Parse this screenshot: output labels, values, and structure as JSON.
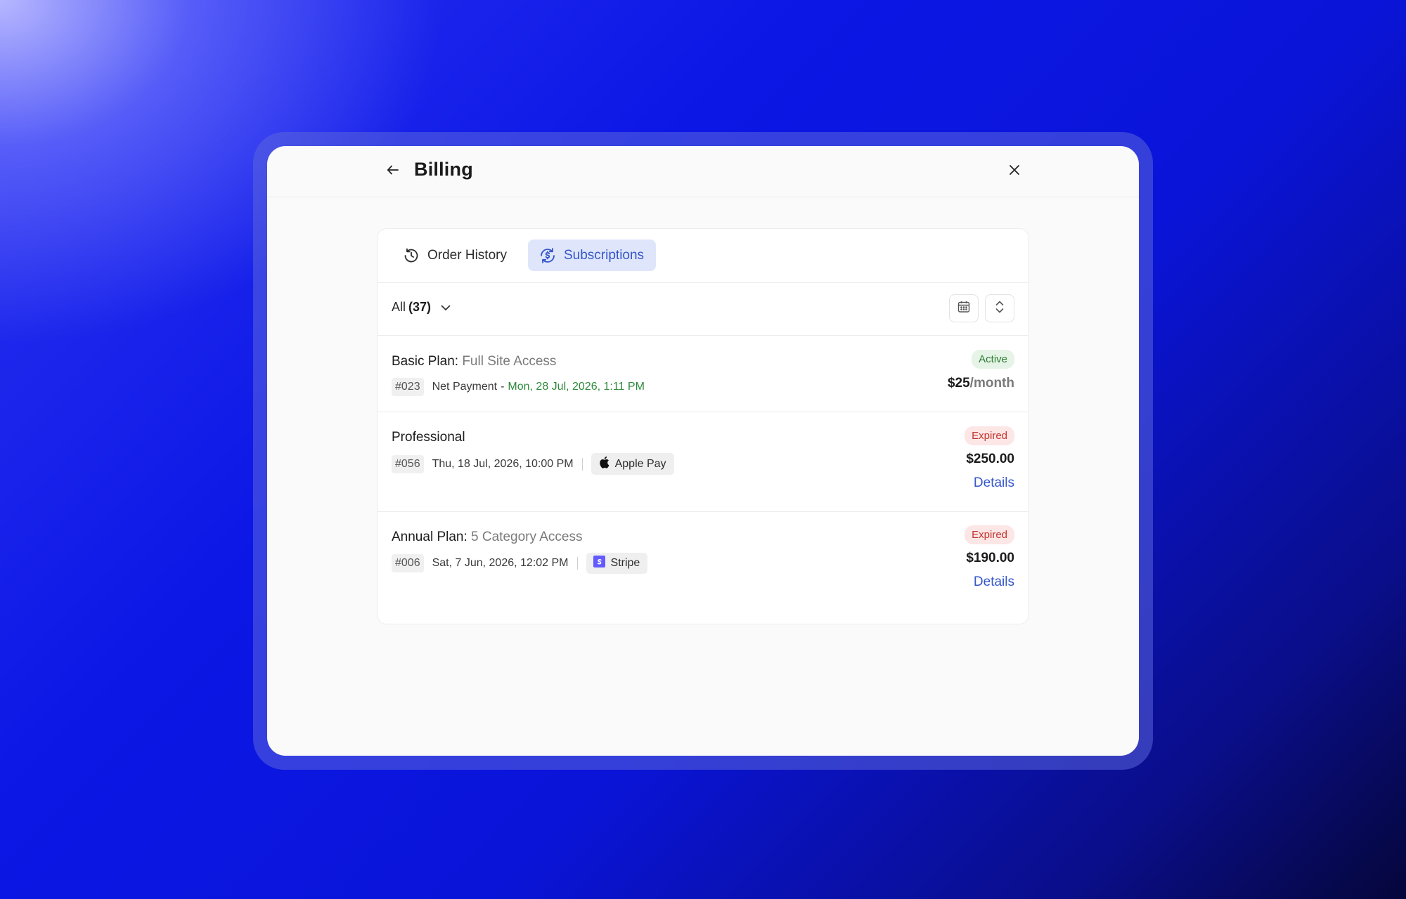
{
  "header": {
    "title": "Billing",
    "back_icon": "arrow-left-icon",
    "close_icon": "close-icon"
  },
  "tabs": [
    {
      "label": "Order History",
      "icon": "history-icon",
      "active": false
    },
    {
      "label": "Subscriptions",
      "icon": "subscription-refresh-dollar-icon",
      "active": true
    }
  ],
  "filter": {
    "label": "All",
    "count": "(37)"
  },
  "toolbar": {
    "calendar_icon": "calendar-icon",
    "sort_icon": "sort-icon"
  },
  "subscriptions": [
    {
      "name": "Basic Plan:",
      "detail": "Full Site Access",
      "id": "#023",
      "payment_label": "Net Payment",
      "date": "Mon, 28 Jul, 2026, 1:11 PM",
      "status": "Active",
      "price": "$25",
      "period": "/month"
    },
    {
      "name": "Professional",
      "id": "#056",
      "date": "Thu, 18 Jul, 2026, 10:00 PM",
      "method": "Apple Pay",
      "method_icon": "apple-icon",
      "status": "Expired",
      "price": "$250.00",
      "action": "Details"
    },
    {
      "name": "Annual Plan:",
      "detail": "5 Category Access",
      "id": "#006",
      "date": "Sat, 7 Jun, 2026, 12:02 PM",
      "method": "Stripe",
      "method_icon": "stripe-icon",
      "status": "Expired",
      "price": "$190.00",
      "action": "Details"
    }
  ],
  "colors": {
    "accent": "#3556c9",
    "active_green": "#2f8a3d",
    "expired_red": "#c2352f",
    "background_blue": "#0c17e6"
  }
}
